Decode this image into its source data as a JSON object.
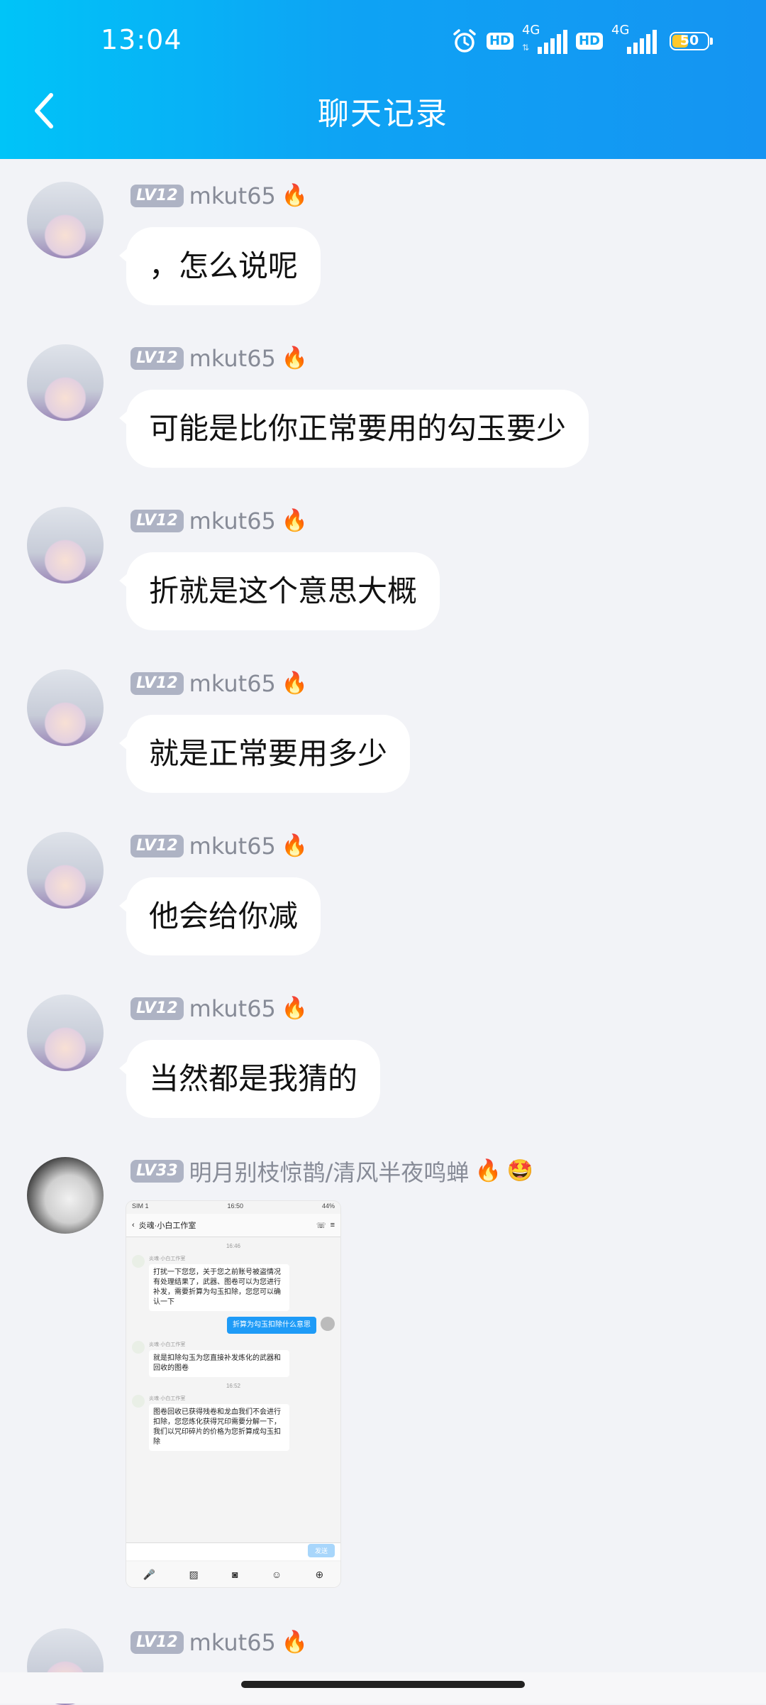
{
  "status_bar": {
    "time": "13:04",
    "network_1": "4G",
    "network_2": "4G",
    "hd_label": "HD",
    "battery_level": 50,
    "battery_text": "50"
  },
  "header": {
    "title": "聊天记录",
    "back_icon": "chevron-left-icon"
  },
  "messages": [
    {
      "level": "LV12",
      "username": "mkut65",
      "badge": "🔥",
      "text": "，怎么说呢"
    },
    {
      "level": "LV12",
      "username": "mkut65",
      "badge": "🔥",
      "text": "可能是比你正常要用的勾玉要少"
    },
    {
      "level": "LV12",
      "username": "mkut65",
      "badge": "🔥",
      "text": "折就是这个意思大概"
    },
    {
      "level": "LV12",
      "username": "mkut65",
      "badge": "🔥",
      "text": "就是正常要用多少"
    },
    {
      "level": "LV12",
      "username": "mkut65",
      "badge": "🔥",
      "text": "他会给你减"
    },
    {
      "level": "LV12",
      "username": "mkut65",
      "badge": "🔥",
      "text": "当然都是我猜的"
    },
    {
      "level": "LV33",
      "username": "明月别枝惊鹊/清风半夜鸣蝉",
      "badge": "🔥",
      "badge2": "🤩",
      "image": {
        "status_time": "16:50",
        "status_carrier": "SIM 1",
        "status_battery": "44%",
        "chat_title": "炎魂·小白工作室",
        "timestamp_1": "16:46",
        "sender_name": "炎魂·小白工作室",
        "msg_1": "打扰一下您您，关于您之前账号被盗情况有处理结果了，武器、图卷可以为您进行补发，需要折算为勾玉扣除，您您可以确认一下",
        "msg_user": "折算为勾玉扣除什么意思",
        "msg_2": "就是扣除勾玉为您直接补发炼化的武器和回收的图卷",
        "timestamp_2": "16:52",
        "msg_3": "图卷回收已获得残卷和龙血我们不会进行扣除，您您炼化获得咒印需要分解一下，我们以咒印碎片的价格为您折算成勾玉扣除",
        "send_label": "发送"
      }
    },
    {
      "level": "LV12",
      "username": "mkut65",
      "badge": "🔥"
    }
  ]
}
